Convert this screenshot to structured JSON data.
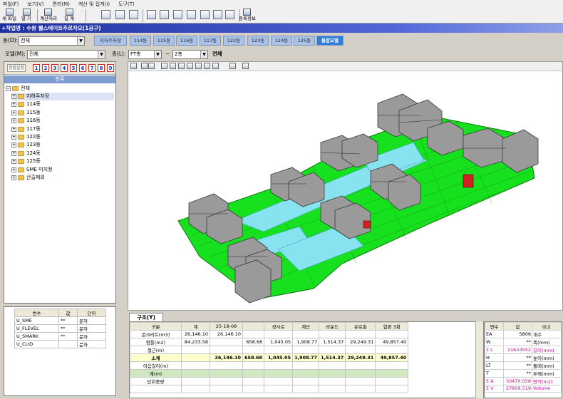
{
  "menu": [
    "파일(F)",
    "보기(V)",
    "편리(M)",
    "계산 및 집계(I)",
    "도구(T)"
  ],
  "toolbar": {
    "new_label": "새 파일",
    "open_label": "열 기",
    "calc_label": "계산처리",
    "sum_label": "집 계",
    "register_label": "등록정보"
  },
  "work_title": "+작업명 : 수원 웰스테이트주르자오(1공구)",
  "dong": {
    "label": "동(D):",
    "value": "전체"
  },
  "tabs": [
    "지하주차장",
    "114동",
    "115동",
    "116동",
    "117동",
    "122동",
    "123동",
    "124동",
    "125동",
    "통합모델"
  ],
  "active_tab": "통합모델",
  "model": {
    "label": "모델(M):",
    "value": "전체"
  },
  "floor": {
    "label": "층(L):",
    "from": "FT층",
    "tilde": "~",
    "to": "2층",
    "all_label": "전체"
  },
  "numbar": {
    "sort_label": "정렬설정",
    "nums": [
      "1",
      "2",
      "3",
      "4",
      "5",
      "6",
      "7",
      "8",
      "9"
    ]
  },
  "tree": {
    "header": "분류",
    "root": "전체",
    "items": [
      "지하주차장",
      "114동",
      "115동",
      "116동",
      "117동",
      "122동",
      "123동",
      "124동",
      "125동",
      "SME 미지정",
      "산출제외"
    ]
  },
  "var_table": {
    "headers": [
      "변수",
      "값",
      "단위"
    ],
    "rows": [
      [
        "U_SME",
        "**",
        "문자"
      ],
      [
        "U_FLEVEL",
        "**",
        "문자"
      ],
      [
        "U_SMARK",
        "**",
        "문자"
      ],
      [
        "U_CLID",
        "",
        "문자"
      ]
    ]
  },
  "bottom_tab": "구조(Y)",
  "grid": {
    "headers": [
      "구분",
      "계",
      "25-18-08",
      "",
      "경사로",
      "계단",
      "라운드",
      "유로홈",
      "합판 3회"
    ],
    "rows": [
      [
        "콘크리트(m3)",
        "26,146.10",
        "26,146.10",
        "",
        "",
        "",
        "",
        "",
        ""
      ],
      [
        "형틀(m2)",
        "84,233.58",
        "",
        "658.68",
        "1,045.05",
        "1,908.77",
        "1,514.37",
        "29,249.31",
        "49,857.40"
      ],
      [
        "철근(m)",
        "",
        "",
        "",
        "",
        "",
        "",
        "",
        ""
      ],
      [
        "소계",
        "",
        "26,146.10",
        "658.68",
        "1,045.05",
        "1,908.77",
        "1,514.37",
        "29,249.31",
        "49,857.40"
      ],
      [
        "이음길이(m)",
        "",
        "",
        "",
        "",
        "",
        "",
        "",
        ""
      ],
      [
        "계(m)",
        "",
        "",
        "",
        "",
        "",
        "",
        "",
        ""
      ],
      [
        "단위중량",
        "",
        "",
        "",
        "",
        "",
        "",
        "",
        ""
      ],
      [
        "",
        "",
        "",
        "",
        "",
        "",
        "",
        "",
        ""
      ]
    ]
  },
  "right_vars": {
    "headers": [
      "변수",
      "값",
      "비고"
    ],
    "rows": [
      [
        "EA",
        "5806",
        "개수"
      ],
      [
        "W",
        "**",
        "폭(mm)"
      ],
      [
        "Σ L",
        "21624552",
        "길이(mm)"
      ],
      [
        "H",
        "**",
        "높이(mm)"
      ],
      [
        "LT",
        "**",
        "둘레(mm)"
      ],
      [
        "T",
        "**",
        "두께(mm)"
      ],
      [
        "Σ A",
        "30470.058",
        "면적(m2)"
      ],
      [
        "Σ V",
        "27809.519",
        "Volume"
      ]
    ]
  },
  "colors": {
    "title_bar": "#2a3eb0",
    "active_tab": "#2f7fd8",
    "tab": "#a9c2e6",
    "model_green": "#17e01e",
    "model_cyan": "#86e3ef",
    "building_gray": "#9a9a9a",
    "subtotal_row": "#ffffcc",
    "pink_text": "#d6009a"
  }
}
